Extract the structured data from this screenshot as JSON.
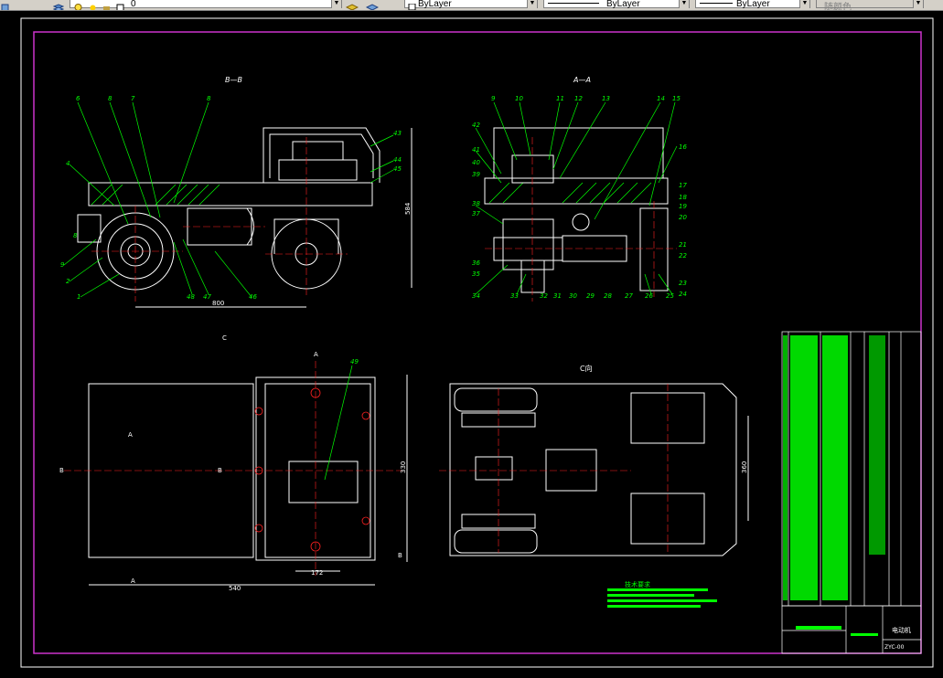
{
  "toolbar": {
    "layer_combo_value": "0",
    "color_combo_value": "ByLayer",
    "linetype_combo_value": "ByLayer",
    "lineweight_combo_value": "ByLayer",
    "plotstyle_combo_value": "随颜色"
  },
  "drawing": {
    "section_bb_title": "B—B",
    "section_aa_title": "A—A",
    "view_c_title": "C向",
    "view_c_marker": "C",
    "tech_req_title": "技术要求",
    "title_block_name": "电动机",
    "title_block_code": "ZYC-00",
    "dim_bb_width": "800",
    "dim_bb_height": "584",
    "dim_plan_width": "540",
    "dim_plan_height": "330",
    "dim_plan_small": "172",
    "dim_c_height": "360",
    "section_letter_a": "A",
    "section_letter_b": "B",
    "callouts_bb": [
      "6",
      "8",
      "7",
      "8",
      "4",
      "8",
      "9",
      "2",
      "1",
      "48",
      "47",
      "46",
      "43",
      "44",
      "45"
    ],
    "callouts_aa": [
      "9",
      "10",
      "11",
      "12",
      "13",
      "14",
      "15",
      "16",
      "17",
      "18",
      "19",
      "20",
      "21",
      "22",
      "23",
      "24",
      "25",
      "26",
      "27",
      "28",
      "29",
      "30",
      "31",
      "32",
      "33",
      "34",
      "35",
      "36",
      "37",
      "38",
      "39",
      "40",
      "41",
      "42"
    ]
  },
  "colors": {
    "background": "#000000",
    "border": "#cc33cc",
    "geometry": "#ffffff",
    "callout": "#00ff00",
    "centerline": "#ff2020",
    "dim_text": "#ffffff"
  }
}
